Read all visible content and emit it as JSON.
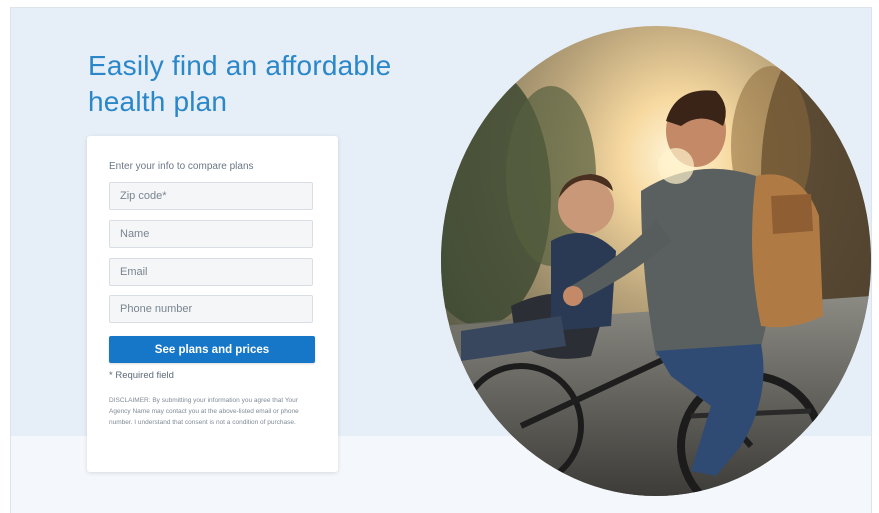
{
  "hero": {
    "title": "Easily find an affordable health plan"
  },
  "form": {
    "intro": "Enter your info to compare plans",
    "zip_placeholder": "Zip code*",
    "name_placeholder": "Name",
    "email_placeholder": "Email",
    "phone_placeholder": "Phone number",
    "submit_label": "See plans and prices",
    "required_note": "* Required field",
    "disclaimer": "DISCLAIMER: By submitting your information you agree that Your Agency Name may contact you at the above-listed email or phone number. I understand that consent is not a condition of purchase."
  },
  "colors": {
    "accent": "#1677c9",
    "title": "#2a87c9",
    "hero_background": "#e6eef8"
  }
}
